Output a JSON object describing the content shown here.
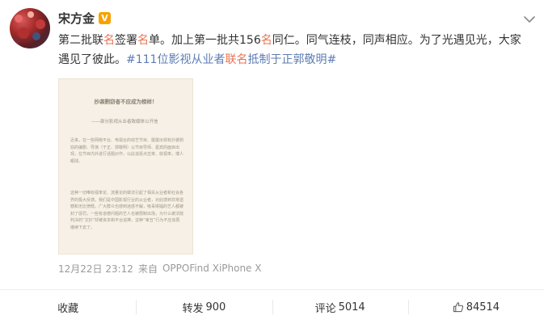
{
  "author": {
    "name": "宋方金",
    "badge": "V"
  },
  "post": {
    "line1_a": "第二批联",
    "line1_b": "名",
    "line1_c": "签署",
    "line1_d": "名",
    "line1_e": "单。加上第一批共156",
    "line1_f": "名",
    "line1_g": "同仁。同气连枝，同声相应。为了光遇见光，大家遇见了彼此。",
    "tag_a": "#111位影视从业者",
    "tag_b": "联名",
    "tag_c": "抵制于正郭敬明#"
  },
  "image": {
    "title": "抄袭剽窃者不应成为榜样！",
    "subtitle": "——部分影视从业者致媒体公开信",
    "para1": "近来，在一些网络平台、电视台的综艺节目、屡屡出现有抄袭剽窃的编剧、导演（于正、郭敬明）以节目导师、嘉宾的面目出现，在节目内外进行话题炒作，以此追逐点击率、收视率，博人眼球。",
    "para2": "这种一切唯收视率论、流量论的做法引起了相关从业者和社会各界的极大反感。我们是中国影视行业的从业者，对此感到非常遗憾和无比愤慨。广大群众也感到迷惑不解，吸毒嫖娼的艺人都被封了惩罚，一些有道德问题的艺人也被限制出场，为什么被法院判决的“文抄”却被资本和平台追捧，这种“审丑”行为不应该再继续下去了。"
  },
  "meta": {
    "time": "12月22日 23:12",
    "from_label": "来自",
    "device": "OPPOFind XiPhone X"
  },
  "actions": {
    "favorite": "收藏",
    "repost_label": "转发",
    "repost_count": "900",
    "comment_label": "评论",
    "comment_count": "5014",
    "like_count": "84514"
  },
  "colors": {
    "highlight": "#eb7350",
    "topic": "#5d7cb3",
    "vip_badge": "#f7a200",
    "meta_text": "#9a9a9a"
  },
  "icons": {
    "more": "chevron-down-icon",
    "like": "thumbs-up-icon",
    "verified": "vip-badge-icon"
  }
}
